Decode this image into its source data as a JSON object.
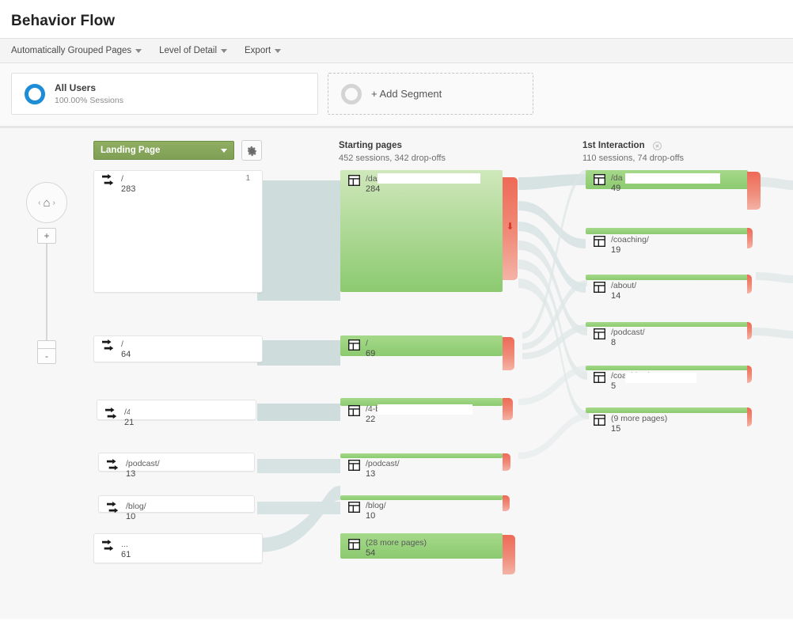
{
  "header": {
    "title": "Behavior Flow"
  },
  "toolbar": {
    "items": [
      {
        "label": "Automatically Grouped Pages",
        "icon": "chevron-down-icon"
      },
      {
        "label": "Level of Detail",
        "icon": "chevron-down-icon"
      },
      {
        "label": "Export",
        "icon": "chevron-down-icon"
      }
    ]
  },
  "segments": {
    "all_users": {
      "name": "All Users",
      "sub": "100.00% Sessions",
      "color": "#1f8dd6"
    },
    "add_segment": {
      "label": "+ Add Segment"
    }
  },
  "controls": {
    "dimension_label": "Landing Page",
    "settings_icon": "gear-icon",
    "home_icon": "home-icon",
    "zoom_in": "+",
    "zoom_out": "-",
    "prev_arrow": "‹",
    "next_arrow": "›"
  },
  "columns": [
    {
      "id": "starting-pages",
      "title": "Starting pages",
      "sub": "452 sessions, 342 drop-offs",
      "removable": false
    },
    {
      "id": "first-interaction",
      "title": "1st Interaction",
      "sub": "110 sessions, 74 drop-offs",
      "removable": true
    }
  ],
  "chart_data": {
    "type": "sankey",
    "title": "Behavior Flow",
    "dimension": "Landing Page",
    "stages": [
      {
        "name": "Landing Page",
        "sessions": null,
        "drop_offs": null,
        "nodes": [
          {
            "path": "/di",
            "redacted": true,
            "value": 283,
            "badge": "1"
          },
          {
            "path": "/",
            "redacted": false,
            "value": 64
          },
          {
            "path": "/4-",
            "redacted": true,
            "value": 21
          },
          {
            "path": "/podcast/",
            "redacted": false,
            "value": 13
          },
          {
            "path": "/blog/",
            "redacted": false,
            "value": 10
          },
          {
            "path": "...",
            "redacted": false,
            "value": 61
          }
        ]
      },
      {
        "name": "Starting pages",
        "sessions": 452,
        "drop_offs": 342,
        "nodes": [
          {
            "path": "/dai",
            "redacted": true,
            "value": 284
          },
          {
            "path": "/",
            "redacted": false,
            "value": 69
          },
          {
            "path": "/4-b",
            "redacted": true,
            "value": 22
          },
          {
            "path": "/podcast/",
            "redacted": false,
            "value": 13
          },
          {
            "path": "/blog/",
            "redacted": false,
            "value": 10
          },
          {
            "path": "(28 more pages)",
            "redacted": false,
            "value": 54
          }
        ]
      },
      {
        "name": "1st Interaction",
        "sessions": 110,
        "drop_offs": 74,
        "nodes": [
          {
            "path": "/da            o/",
            "redacted": true,
            "value": 49
          },
          {
            "path": "/coaching/",
            "redacted": false,
            "value": 19
          },
          {
            "path": "/about/",
            "redacted": false,
            "value": 14
          },
          {
            "path": "/podcast/",
            "redacted": false,
            "value": 8
          },
          {
            "path": "/coaching/",
            "redacted": true,
            "value": 5
          },
          {
            "path": "(9 more pages)",
            "redacted": false,
            "value": 15
          }
        ]
      }
    ],
    "colors": {
      "node_green_top": "#cfe8bb",
      "node_green_bottom": "#8cca70",
      "dropoff_red": "#ee6a57",
      "connector": "#cfdcdc",
      "dimension_button": "#8fae62",
      "segment_blue": "#1f8dd6"
    }
  }
}
